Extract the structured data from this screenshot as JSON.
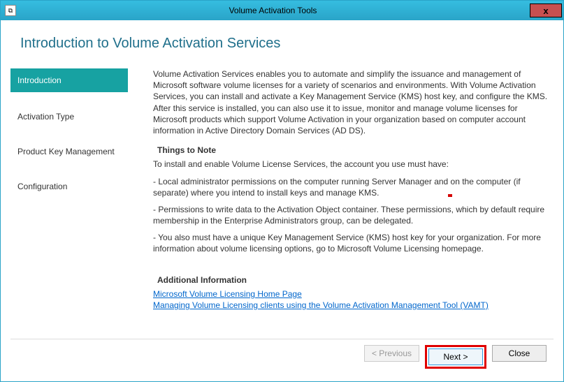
{
  "titlebar": {
    "title": "Volume Activation Tools",
    "close_glyph": "x"
  },
  "page": {
    "title": "Introduction to Volume Activation Services"
  },
  "nav": {
    "items": [
      {
        "label": "Introduction",
        "selected": true
      },
      {
        "label": "Activation Type",
        "selected": false
      },
      {
        "label": "Product Key Management",
        "selected": false
      },
      {
        "label": "Configuration",
        "selected": false
      }
    ]
  },
  "main": {
    "intro_paragraph": "Volume Activation Services enables you to automate and simplify the issuance and management of Microsoft software volume licenses for a variety of scenarios and environments. With Volume Activation Services, you can install and activate a Key Management Service (KMS) host key, and configure the KMS. After this service is installed, you can also use it to issue, monitor and manage volume licenses for Microsoft products which support Volume Activation in your organization based on computer account information in Active Directory Domain Services (AD DS).",
    "things_heading": "Things to Note",
    "things_intro": "To install and enable Volume License Services, the account you use must have:",
    "things_b1": "- Local administrator permissions on the computer running Server Manager and on the computer (if separate) where you intend to install keys and manage KMS.",
    "things_b2": "- Permissions to write data to the Activation Object container. These permissions, which by default require membership in the Enterprise Administrators group, can be delegated.",
    "things_b3": "- You also must have a unique Key Management Service (KMS) host key for your organization. For more information about volume licensing options, go to Microsoft Volume Licensing homepage.",
    "additional_heading": "Additional Information",
    "link1": "Microsoft Volume Licensing Home Page",
    "link2": "Managing Volume Licensing clients using the Volume Activation Management Tool (VAMT)"
  },
  "footer": {
    "previous_label": "< Previous",
    "next_label": "Next >",
    "close_label": "Close"
  }
}
